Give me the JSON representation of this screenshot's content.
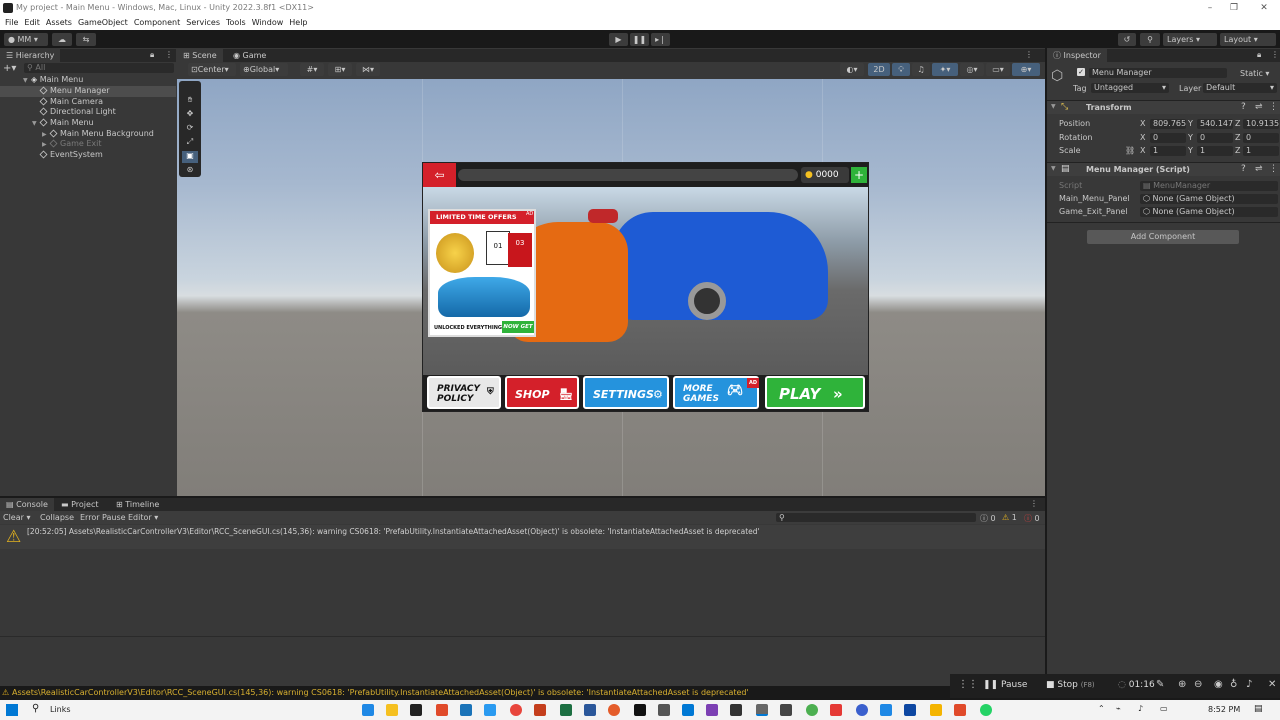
{
  "window": {
    "title": "My project - Main Menu - Windows, Mac, Linux - Unity 2022.3.8f1 <DX11>"
  },
  "menu": [
    "File",
    "Edit",
    "Assets",
    "GameObject",
    "Component",
    "Services",
    "Tools",
    "Window",
    "Help"
  ],
  "toolbar": {
    "account": "MM",
    "layers": "Layers",
    "layout": "Layout"
  },
  "hierarchy": {
    "tab": "Hierarchy",
    "search_placeholder": "All",
    "items": [
      {
        "label": "Main Menu"
      },
      {
        "label": "Menu Manager"
      },
      {
        "label": "Main Camera"
      },
      {
        "label": "Directional Light"
      },
      {
        "label": "Main Menu"
      },
      {
        "label": "Main Menu Background"
      },
      {
        "label": "Game Exit"
      },
      {
        "label": "EventSystem"
      }
    ]
  },
  "views": {
    "scene_tab": "Scene",
    "game_tab": "Game",
    "pivot": "Center",
    "space": "Global",
    "mode_2d": "2D"
  },
  "game": {
    "coins": "0000",
    "offer_title": "LIMITED TIME OFFERS",
    "offer_card_1": "01",
    "offer_card_2": "03",
    "offer_footer": "UNLOCKED EVERYTHINGS",
    "offer_cta": "NOW GET",
    "ad_tag": "AD",
    "buttons": {
      "privacy": "PRIVACY POLICY",
      "shop": "SHOP",
      "settings": "SETTINGS",
      "more_games": "MORE GAMES",
      "play": "PLAY"
    }
  },
  "inspector": {
    "tab": "Inspector",
    "object_name": "Menu Manager",
    "static_label": "Static",
    "tag_label": "Tag",
    "tag_value": "Untagged",
    "layer_label": "Layer",
    "layer_value": "Default",
    "transform": {
      "title": "Transform",
      "position_label": "Position",
      "rotation_label": "Rotation",
      "scale_label": "Scale",
      "position": {
        "x": "809.765",
        "y": "540.147",
        "z": "10.9135"
      },
      "rotation": {
        "x": "0",
        "y": "0",
        "z": "0"
      },
      "scale": {
        "x": "1",
        "y": "1",
        "z": "1"
      }
    },
    "script": {
      "title": "Menu Manager (Script)",
      "script_label": "Script",
      "script_value": "MenuManager",
      "field1_label": "Main_Menu_Panel",
      "field1_value": "None (Game Object)",
      "field2_label": "Game_Exit_Panel",
      "field2_value": "None (Game Object)"
    },
    "add_component": "Add Component"
  },
  "console": {
    "tabs": [
      "Console",
      "Project",
      "Timeline"
    ],
    "toolbar": {
      "clear": "Clear",
      "collapse": "Collapse",
      "error_pause": "Error Pause",
      "editor": "Editor"
    },
    "counts": {
      "log": "0",
      "warn": "1",
      "error": "0"
    },
    "message": "[20:52:05] Assets\\RealisticCarControllerV3\\Editor\\RCC_SceneGUI.cs(145,36): warning CS0618: 'PrefabUtility.InstantiateAttachedAsset(Object)' is obsolete: 'InstantiateAttachedAsset is deprecated'"
  },
  "statusbar": {
    "message": "Assets\\RealisticCarControllerV3\\Editor\\RCC_SceneGUI.cs(145,36): warning CS0618: 'PrefabUtility.InstantiateAttachedAsset(Object)' is obsolete: 'InstantiateAttachedAsset is deprecated'"
  },
  "recorder": {
    "pause": "Pause",
    "stop": "Stop",
    "stop_key": "(F8)",
    "time": "01:16"
  },
  "taskbar": {
    "search": "Links",
    "clock": "8:52 PM"
  }
}
